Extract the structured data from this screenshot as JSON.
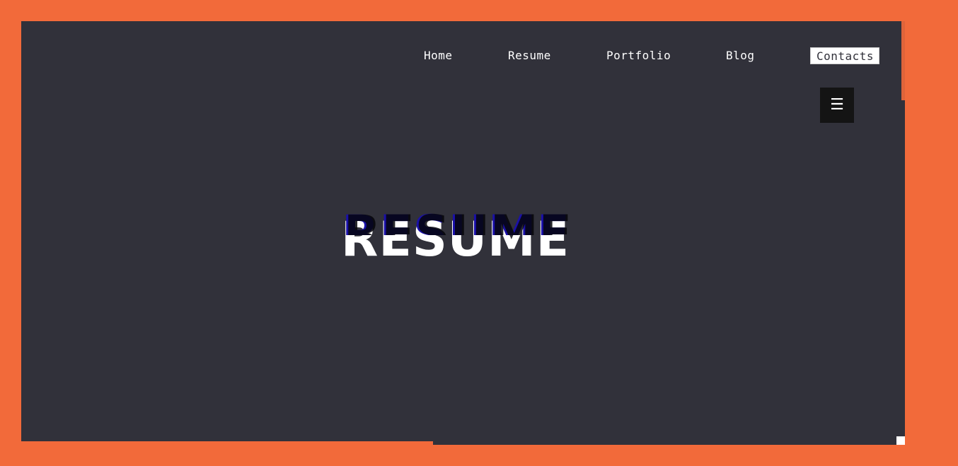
{
  "nav": {
    "items": [
      {
        "label": "Home"
      },
      {
        "label": "Resume"
      },
      {
        "label": "Portfolio"
      },
      {
        "label": "Blog"
      },
      {
        "label": "Contacts"
      }
    ],
    "menu_icon": "☰"
  },
  "hero": {
    "title": "RESUME"
  },
  "colors": {
    "background": "#f26a3a",
    "panel": "#31313a",
    "text": "#ffffff",
    "menu_button": "#141414",
    "title_shadow_blue": "#1a10a8"
  },
  "icons": {
    "menu": "hamburger-icon"
  }
}
